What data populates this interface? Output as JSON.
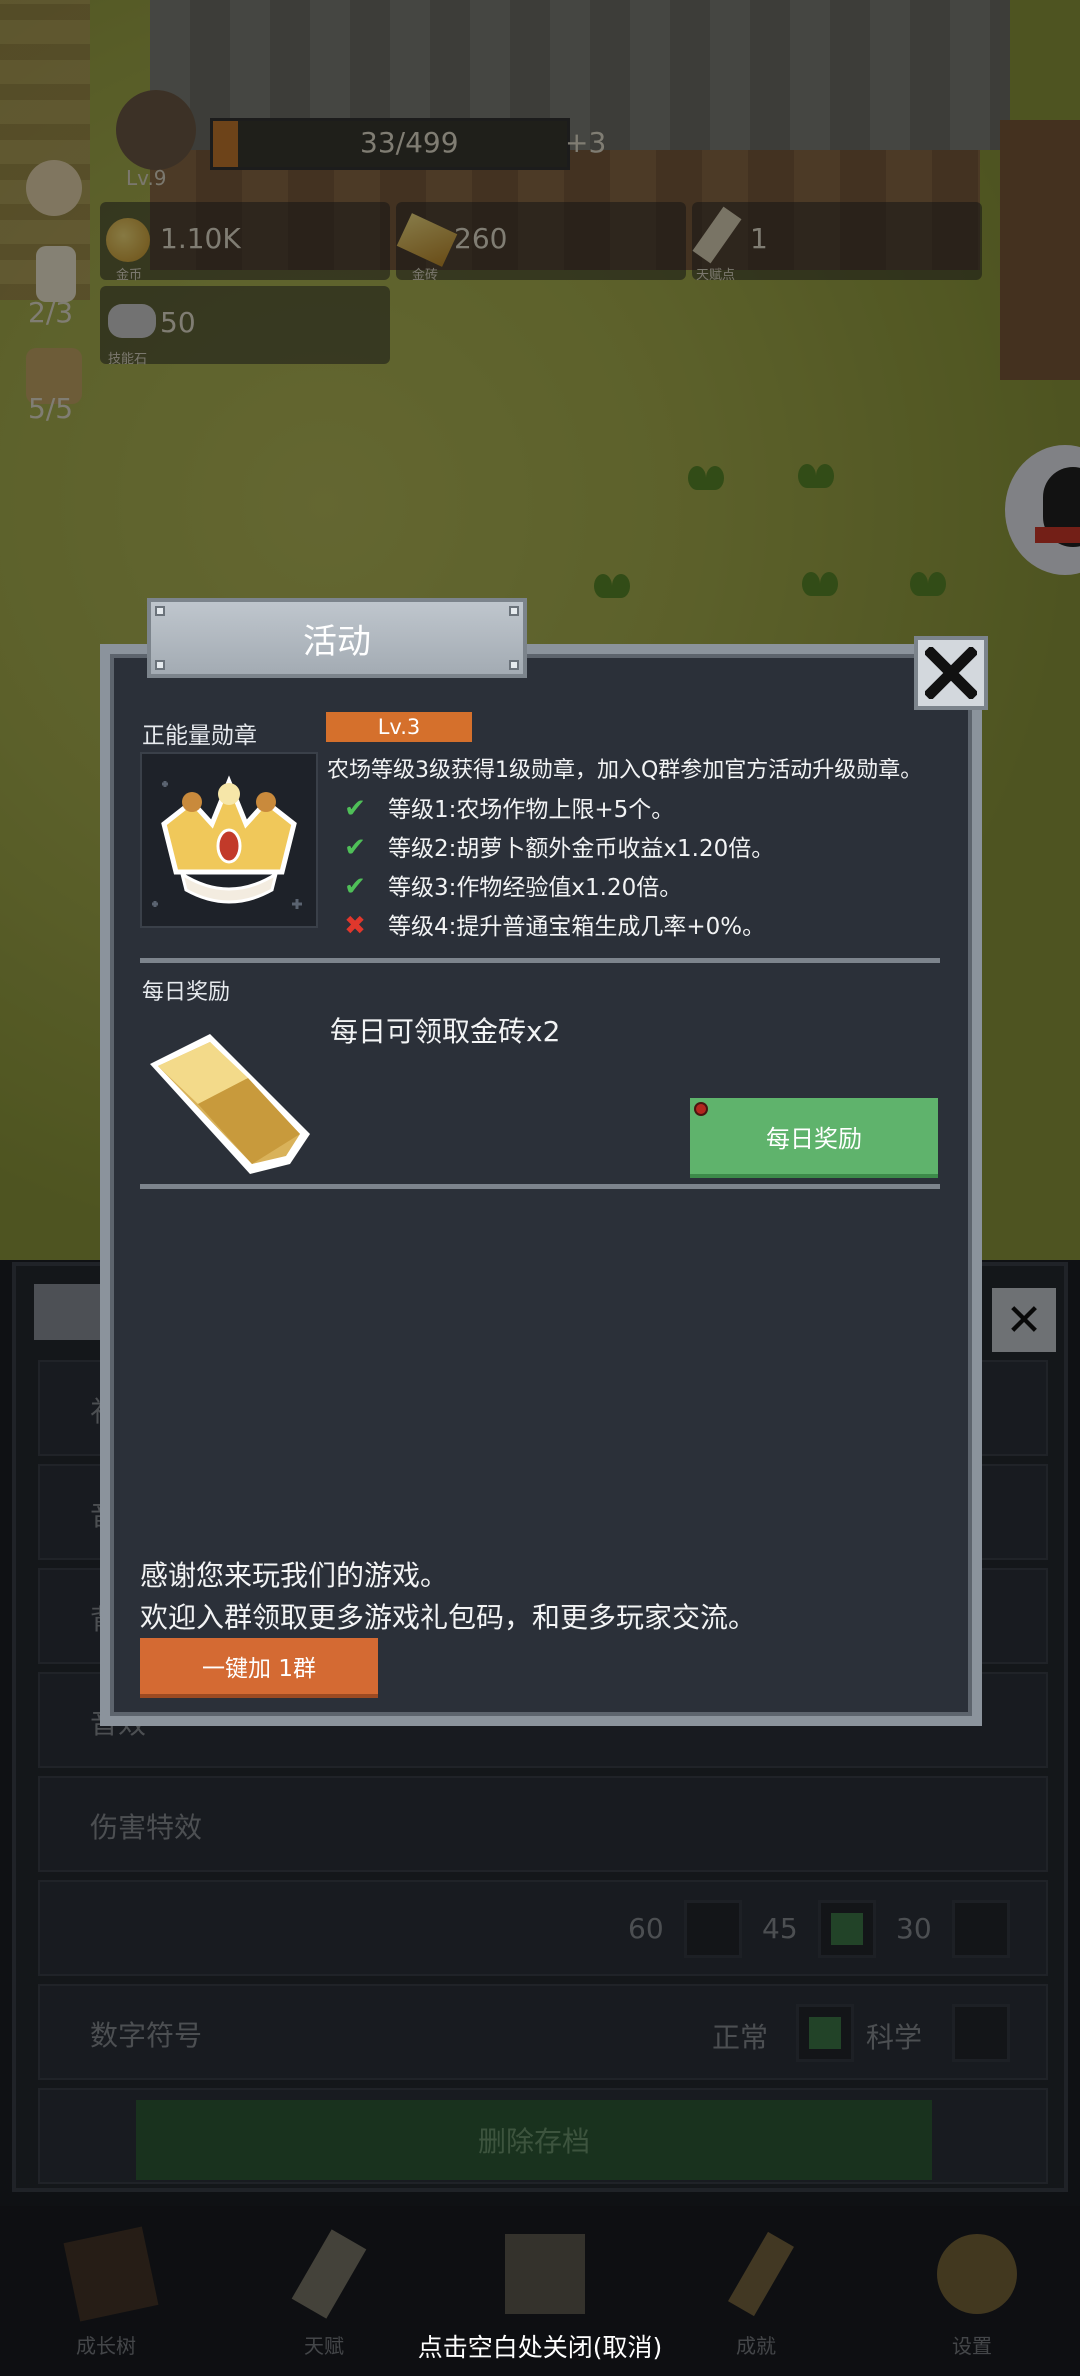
{
  "hud": {
    "level": "Lv.9",
    "xp": "33/499",
    "xp_bonus": "+3",
    "xp_progress": 0.07,
    "gold_coin_value": "1.10K",
    "gold_coin_caption": "金币",
    "gold_bar_value": "260",
    "gold_bar_caption": "金砖",
    "talent_point_value": "1",
    "talent_point_caption": "天赋点",
    "skill_stone_value": "50",
    "skill_stone_caption": "技能石",
    "candle_count": "2/3",
    "jar_count": "5/5"
  },
  "settings_bg": {
    "row_labels": [
      "礼",
      "音",
      "背",
      "音效",
      "伤害特效",
      "",
      "数字符号"
    ],
    "fps_options": [
      "60",
      "45",
      "30"
    ],
    "fps_selected": "45",
    "number_options": [
      "正常",
      "科学"
    ],
    "number_selected": "正常",
    "delete_label": "删除存档"
  },
  "nav": {
    "items": [
      {
        "label": "成长树",
        "icon": "book-icon"
      },
      {
        "label": "天赋",
        "icon": "scroll-icon"
      },
      {
        "label": "",
        "icon": "map-icon"
      },
      {
        "label": "成就",
        "icon": "key-icon"
      },
      {
        "label": "设置",
        "icon": "gear-icon"
      }
    ]
  },
  "dialog": {
    "title": "活动",
    "medal": {
      "section_label": "正能量勋章",
      "level_badge": "Lv.3",
      "description": "农场等级3级获得1级勋章，加入Q群参加官方活动升级勋章。",
      "levels": [
        {
          "status": "done",
          "text": "等级1:农场作物上限+5个。"
        },
        {
          "status": "done",
          "text": "等级2:胡萝卜额外金币收益x1.20倍。"
        },
        {
          "status": "done",
          "text": "等级3:作物经验值x1.20倍。"
        },
        {
          "status": "locked",
          "text": "等级4:提升普通宝箱生成几率+0%。"
        }
      ]
    },
    "daily": {
      "section_label": "每日奖励",
      "reward_text": "每日可领取金砖x2",
      "button_label": "每日奖励"
    },
    "thanks_line1": "感谢您来玩我们的游戏。",
    "thanks_line2": "欢迎入群领取更多游戏礼包码，和更多玩家交流。",
    "join_button": "一键加 1群"
  },
  "close_hint": "点击空白处关闭(取消)",
  "colors": {
    "accent_orange": "#d5702c",
    "accent_green": "#5fb36c",
    "panel_bg": "#2b3039",
    "frame_gray": "#8b939c"
  }
}
